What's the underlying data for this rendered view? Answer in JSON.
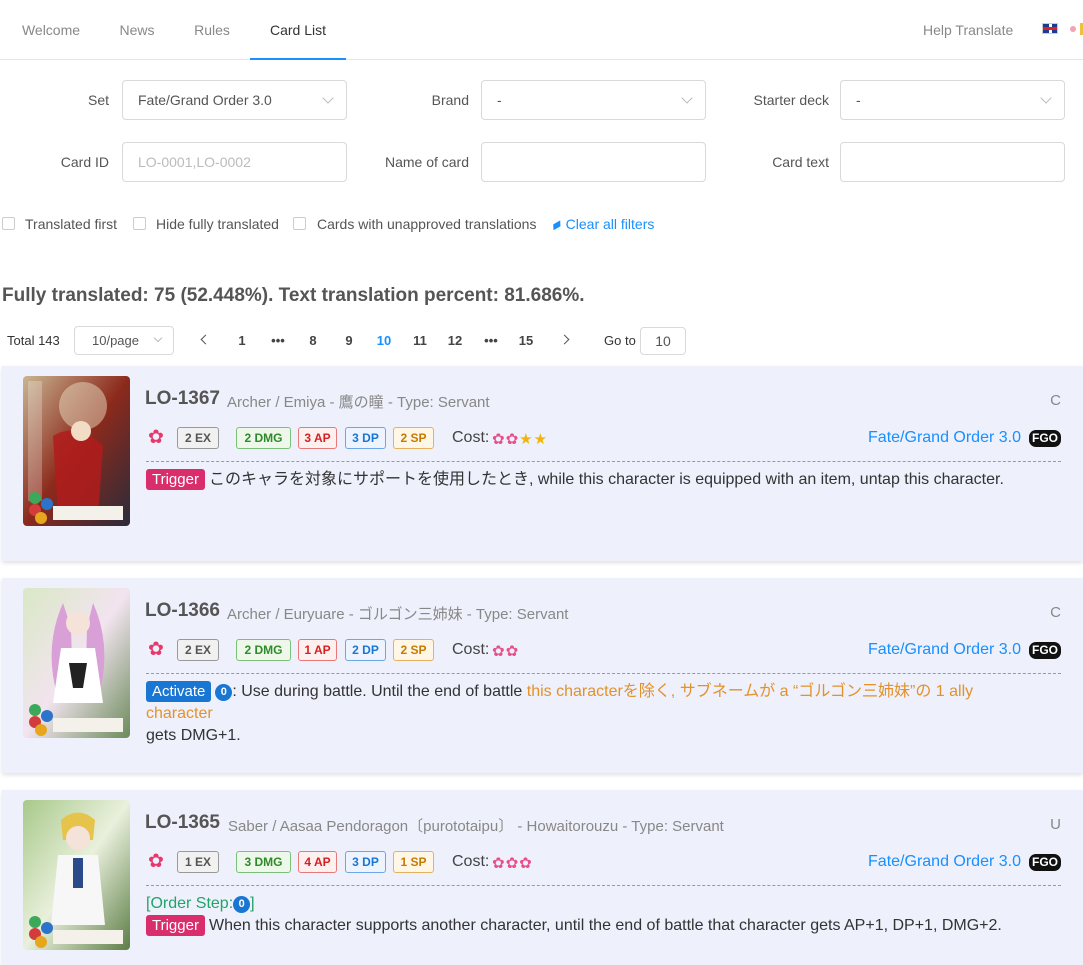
{
  "nav": {
    "tabs": [
      "Welcome",
      "News",
      "Rules",
      "Card List"
    ],
    "help": "Help Translate"
  },
  "filters": {
    "set_label": "Set",
    "set_value": "Fate/Grand Order 3.0",
    "brand_label": "Brand",
    "brand_value": "-",
    "starter_label": "Starter deck",
    "starter_value": "-",
    "cardid_label": "Card ID",
    "cardid_placeholder": "LO-0001,LO-0002",
    "name_label": "Name of card",
    "text_label": "Card text",
    "checkboxes": [
      "Translated first",
      "Hide fully translated",
      "Cards with unapproved translations"
    ],
    "clear": "Clear all filters"
  },
  "stats": "Fully translated: 75 (52.448%). Text translation percent: 81.686%.",
  "pagination": {
    "total": "Total 143",
    "page_size": "10/page",
    "pages": [
      "1",
      "•••",
      "8",
      "9",
      "10",
      "11",
      "12",
      "•••",
      "15"
    ],
    "current": "10",
    "goto_label": "Go to",
    "goto_value": "10"
  },
  "cards": [
    {
      "id": "LO-1367",
      "subtitle": "Archer / Emiya - 鷹の瞳 - Type: Servant",
      "rarity": "C",
      "ex": "2 EX",
      "dmg": "2 DMG",
      "ap": "3 AP",
      "dp": "3 DP",
      "sp": "2 SP",
      "cost_label": "Cost:",
      "set": "Fate/Grand Order 3.0",
      "badge": "FGO",
      "tag": "Trigger",
      "text": "このキャラを対象にサポートを使用したとき, while this character is equipped with an item, untap this character."
    },
    {
      "id": "LO-1366",
      "subtitle": "Archer / Euryuare - ゴルゴン三姉妹 - Type: Servant",
      "rarity": "C",
      "ex": "2 EX",
      "dmg": "2 DMG",
      "ap": "1 AP",
      "dp": "2 DP",
      "sp": "2 SP",
      "cost_label": "Cost:",
      "set": "Fate/Grand Order 3.0",
      "badge": "FGO",
      "tag": "Activate",
      "circle": "0",
      "text_a": ": Use during battle. Until the end of battle ",
      "text_b": "this characterを除く, サブネームが a “ゴルゴン三姉妹”の 1 ally character",
      "text_c": "gets DMG+1."
    },
    {
      "id": "LO-1365",
      "subtitle": "Saber / Aasaa Pendoragon〔purototaipu〕 - Howaitorouzu - Type: Servant",
      "rarity": "U",
      "ex": "1 EX",
      "dmg": "3 DMG",
      "ap": "4 AP",
      "dp": "3 DP",
      "sp": "1 SP",
      "cost_label": "Cost:",
      "set": "Fate/Grand Order 3.0",
      "badge": "FGO",
      "order_step_a": "[Order Step:",
      "circle": "0",
      "order_step_b": "]",
      "tag": "Trigger",
      "text": "When this character supports another character, until the end of battle that character gets AP+1, DP+1, DMG+2."
    }
  ],
  "colors": {
    "accent": "#1890ff",
    "trigger": "#d92d6c",
    "activate": "#1976d2",
    "card_bg": "#eef0fb"
  }
}
